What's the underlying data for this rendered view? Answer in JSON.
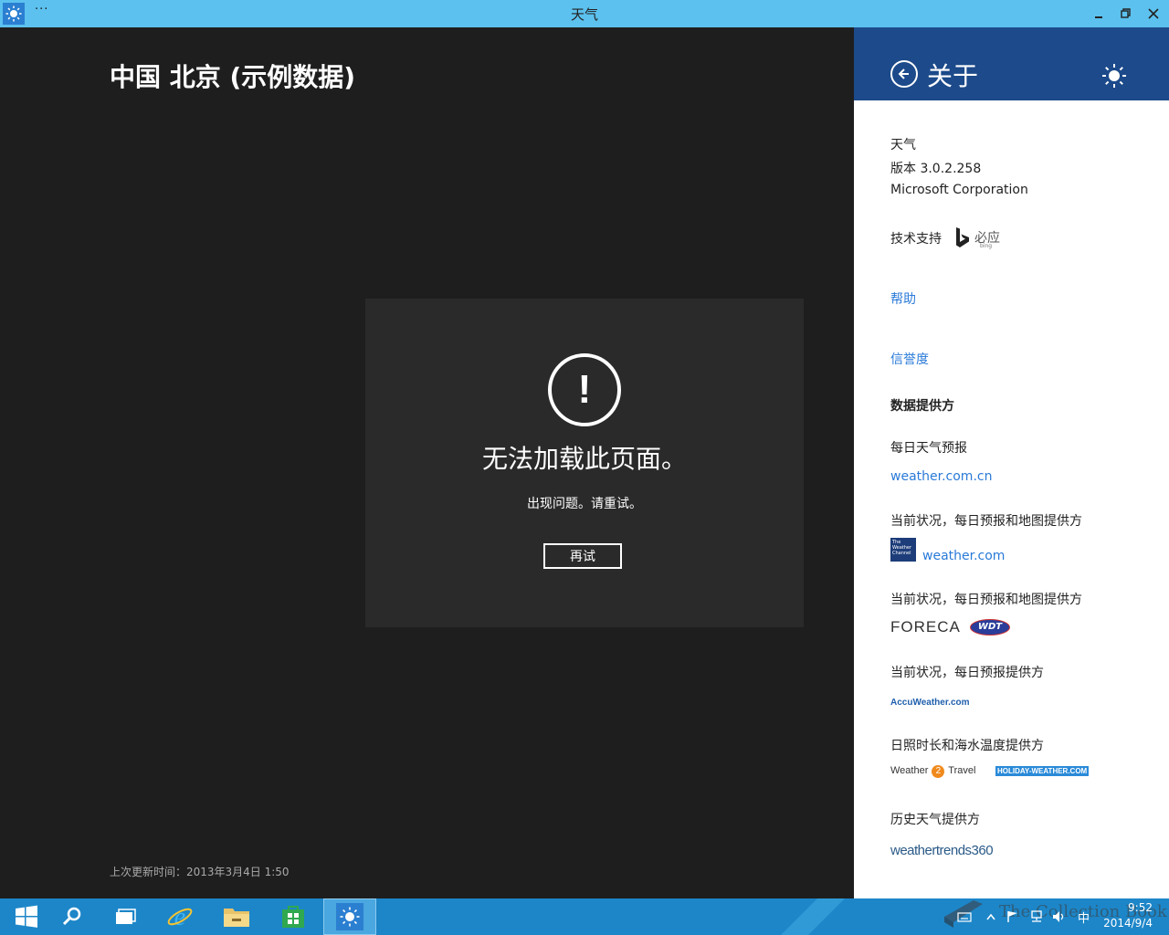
{
  "window": {
    "title": "天气",
    "more_label": "···"
  },
  "main": {
    "city_title": "中国 北京 (示例数据)",
    "error": {
      "icon_glyph": "!",
      "title": "无法加载此页面。",
      "subtitle": "出现问题。请重试。",
      "retry_label": "再试"
    },
    "last_updated": "上次更新时间：2013年3月4日 1:50"
  },
  "about_panel": {
    "title": "关于",
    "app_name": "天气",
    "version": "版本 3.0.2.258",
    "company": "Microsoft Corporation",
    "powered_by_label": "技术支持",
    "bing_logo_text": "必应",
    "bing_logo_subtext": "bing",
    "help_link": "帮助",
    "credits_link": "信誉度",
    "data_providers_heading": "数据提供方",
    "providers": [
      {
        "label": "每日天气预报",
        "link": "weather.com.cn"
      },
      {
        "label": "当前状况，每日预报和地图提供方",
        "logo_text": "The Weather Channel",
        "link": "weather.com"
      },
      {
        "label": "当前状况，每日预报和地图提供方",
        "logo_text": "FORECA",
        "logo2_text": "WDT"
      },
      {
        "label": "当前状况，每日预报提供方",
        "logo_text": "AccuWeather.com"
      },
      {
        "label": "日照时长和海水温度提供方",
        "logo_text_left": "Weather",
        "logo_text_mid": "2",
        "logo_text_right": "Travel",
        "logo2_text": "HOLIDAY-WEATHER.COM"
      },
      {
        "label": "历史天气提供方",
        "logo_text": "weathertrends360"
      }
    ]
  },
  "taskbar": {
    "ime_label": "中",
    "clock_time": "9:52",
    "clock_date": "2014/9/4",
    "watermark": "The Collection Book"
  },
  "colors": {
    "titlebar": "#5cc1ee",
    "main_bg": "#1e1e1e",
    "error_box": "#2a2a2a",
    "panel_header": "#1c4a8a",
    "link": "#2a7ad8",
    "taskbar": "#1d86c8"
  }
}
